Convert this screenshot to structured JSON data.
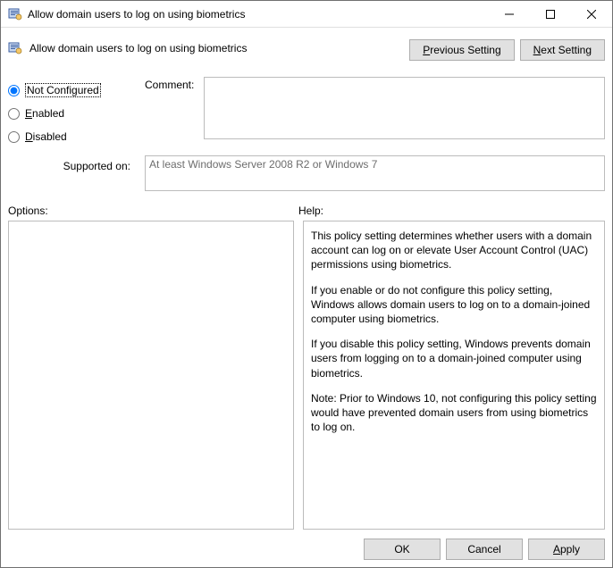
{
  "window": {
    "title": "Allow domain users to log on using biometrics"
  },
  "header": {
    "title": "Allow domain users to log on using biometrics",
    "prev": "Previous Setting",
    "next": "Next Setting"
  },
  "radios": {
    "not_configured": "Not Configured",
    "enabled": "Enabled",
    "disabled": "Disabled",
    "selected": "not_configured"
  },
  "comment": {
    "label": "Comment:",
    "value": ""
  },
  "supported": {
    "label": "Supported on:",
    "value": "At least Windows Server 2008 R2 or Windows 7"
  },
  "labels": {
    "options": "Options:",
    "help": "Help:"
  },
  "help": {
    "p1": "This policy setting determines whether users with a domain account can log on or elevate User Account Control (UAC) permissions using biometrics.",
    "p2": "If you enable or do not configure this policy setting, Windows allows domain users to log on to a domain-joined computer using biometrics.",
    "p3": "If you disable this policy setting, Windows prevents domain users from logging on to a domain-joined computer using biometrics.",
    "p4": "Note: Prior to Windows 10, not configuring this policy setting would have prevented domain users from using biometrics to log on."
  },
  "footer": {
    "ok": "OK",
    "cancel": "Cancel",
    "apply": "Apply"
  }
}
